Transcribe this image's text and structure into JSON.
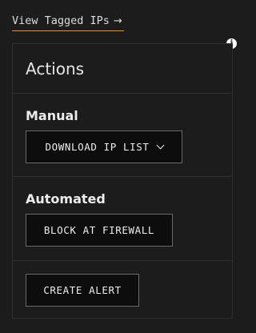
{
  "link": {
    "label": "View Tagged IPs",
    "arrow": "→"
  },
  "info_icon": {
    "glyph": "i",
    "icon": "info-icon"
  },
  "panel": {
    "title": "Actions",
    "manual": {
      "label": "Manual",
      "download_button": "DOWNLOAD IP LIST",
      "download_icon": "chevron-down-icon"
    },
    "automated": {
      "label": "Automated",
      "block_button": "BLOCK AT FIREWALL"
    },
    "alert": {
      "create_button": "CREATE ALERT"
    }
  },
  "colors": {
    "background": "#1c1c1c",
    "link_underline": "#c79a5a",
    "button_bg": "#0d0d0d",
    "button_border": "#6a6a6a"
  }
}
